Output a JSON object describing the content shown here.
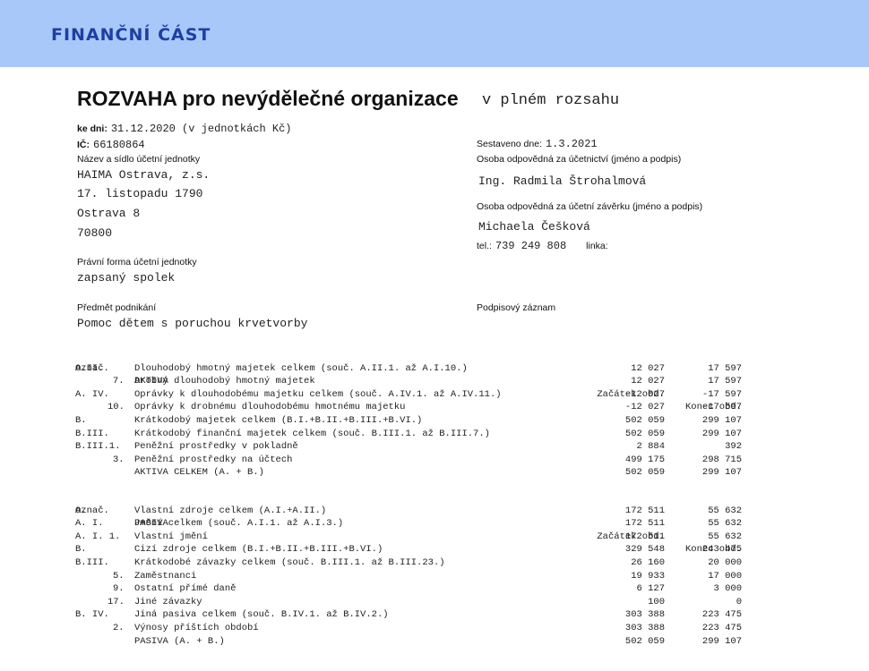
{
  "header": {
    "title": "FINANČNÍ ČÁST"
  },
  "document": {
    "title": "ROZVAHA pro nevýdělečné organizace",
    "subtitle": "v plném rozsahu",
    "ke_dni_label": "ke dni:",
    "ke_dni_value": "31.12.2020 (v jednotkách Kč)",
    "ic_label": "IČ:",
    "ic_value": "66180864",
    "nazev_label": "Název a sídlo účetní jednotky",
    "nazev_lines": [
      "HAIMA Ostrava, z.s.",
      "17. listopadu 1790",
      "Ostrava 8",
      "70800"
    ],
    "pravni_forma_label": "Právní forma účetní jednotky",
    "pravni_forma_value": "zapsaný spolek",
    "predmet_label": "Předmět podnikání",
    "predmet_value": "Pomoc dětem s poruchou krvetvorby",
    "sestaveno_label": "Sestaveno dne:",
    "sestaveno_value": "1.3.2021",
    "osoba_ucetnictvi_label": "Osoba odpovědná za účetnictví (jméno a podpis)",
    "osoba_ucetnictvi_value": "Ing. Radmila Štrohalmová",
    "osoba_zaverka_label": "Osoba odpovědná za účetní závěrku (jméno a podpis)",
    "osoba_zaverka_value": "Michaela Češková",
    "tel_label": "tel.:",
    "tel_value": "739 249 808",
    "linka_label": "linka:",
    "podpisovy_label": "Podpisový záznam"
  },
  "aktiva": {
    "header": {
      "code": "Označ.",
      "desc": "AKTIVA",
      "start": "Začátek obd.",
      "end": "Konec obd."
    },
    "rows": [
      {
        "code": "A.II.",
        "desc": "Dlouhodobý hmotný majetek celkem (souč. A.II.1. až A.I.10.)",
        "start": "12 027",
        "end": "17 597"
      },
      {
        "code": "7.",
        "desc": "Drobný dlouhodobý hmotný majetek",
        "start": "12 027",
        "end": "17 597"
      },
      {
        "code": "A. IV.",
        "desc": "Oprávky k dlouhodobému majetku celkem (souč. A.IV.1. až A.IV.11.)",
        "start": "-12 027",
        "end": "-17 597"
      },
      {
        "code": "10.",
        "desc": "Oprávky k drobnému dlouhodobému hmotnému majetku",
        "start": "-12 027",
        "end": "-17 597"
      },
      {
        "code": "B.",
        "desc": "Krátkodobý majetek celkem (B.I.+B.II.+B.III.+B.VI.)",
        "start": "502 059",
        "end": "299 107"
      },
      {
        "code": "B.III.",
        "desc": "Krátkodobý finanční majetek celkem (souč. B.III.1. až B.III.7.)",
        "start": "502 059",
        "end": "299 107"
      },
      {
        "code": "B.III.1.",
        "desc": "Peněžní prostředky v pokladně",
        "start": "2 884",
        "end": "392"
      },
      {
        "code": "3.",
        "desc": "Peněžní prostředky na účtech",
        "start": "499 175",
        "end": "298 715"
      },
      {
        "code": "",
        "desc": "AKTIVA CELKEM (A. + B.)",
        "start": "502 059",
        "end": "299 107"
      }
    ]
  },
  "pasiva": {
    "header": {
      "code": "Označ.",
      "desc": "PASIVA",
      "start": "Začátek obd.",
      "end": "Konec obd."
    },
    "rows": [
      {
        "code": "A.",
        "desc": "Vlastní zdroje celkem (A.I.+A.II.)",
        "start": "172 511",
        "end": "55 632"
      },
      {
        "code": "A. I.",
        "desc": "Jmění celkem (souč. A.I.1. až A.I.3.)",
        "start": "172 511",
        "end": "55 632"
      },
      {
        "code": "A. I. 1.",
        "desc": "Vlastní jmění",
        "start": "172 511",
        "end": "55 632"
      },
      {
        "code": "B.",
        "desc": "Cizí zdroje celkem (B.I.+B.II.+B.III.+B.VI.)",
        "start": "329 548",
        "end": "243 475"
      },
      {
        "code": "B.III.",
        "desc": "Krátkodobé závazky celkem (souč. B.III.1. až B.III.23.)",
        "start": "26 160",
        "end": "20 000"
      },
      {
        "code": "5.",
        "desc": "Zaměstnanci",
        "start": "19 933",
        "end": "17 000"
      },
      {
        "code": "9.",
        "desc": "Ostatní přímé daně",
        "start": "6 127",
        "end": "3 000"
      },
      {
        "code": "17.",
        "desc": "Jiné závazky",
        "start": "100",
        "end": "0"
      },
      {
        "code": "B. IV.",
        "desc": "Jiná pasiva celkem (souč. B.IV.1. až B.IV.2.)",
        "start": "303 388",
        "end": "223 475"
      },
      {
        "code": "2.",
        "desc": "Výnosy příštích období",
        "start": "303 388",
        "end": "223 475"
      },
      {
        "code": "",
        "desc": "PASIVA (A. + B.)",
        "start": "502 059",
        "end": "299 107"
      }
    ]
  }
}
